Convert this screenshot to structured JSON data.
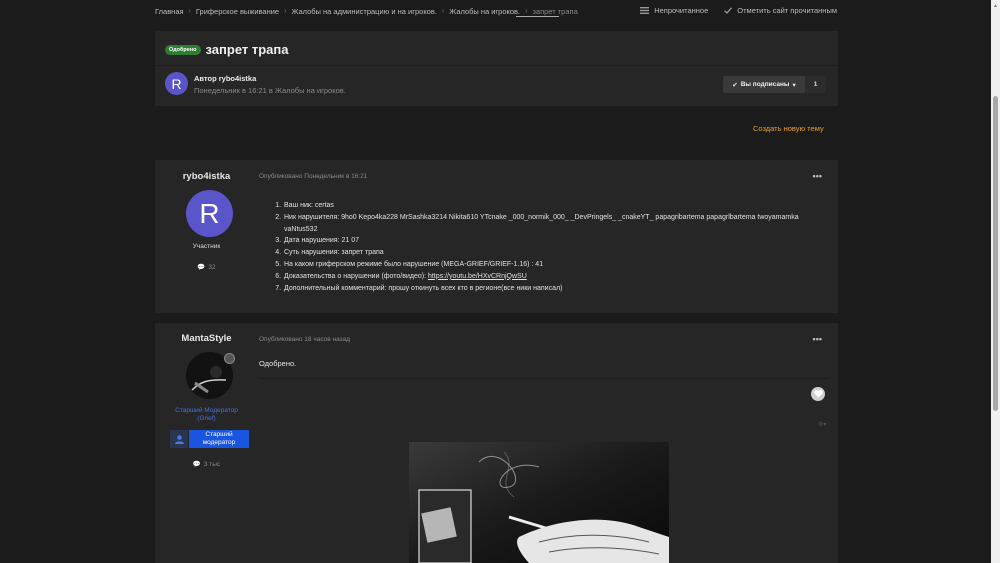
{
  "breadcrumb": {
    "items": [
      "Главная",
      "Гриферское выживание",
      "Жалобы на администрацию и на игроков.",
      "Жалобы на игроков.",
      "запрет трапа"
    ],
    "unread": "Непрочитанное",
    "mark_read": "Отметить сайт прочитанным"
  },
  "topic": {
    "badge": "Одобрено",
    "title": "запрет трапа",
    "author_initial": "R",
    "author_line": "Автор rybo4istka",
    "meta": "Понедельник в 16:21 в Жалобы на игроков.",
    "follow_label": "Вы подписаны",
    "follow_count": "1"
  },
  "new_topic": "Создать новую тему",
  "post1": {
    "username": "rybo4istka",
    "initial": "R",
    "role": "Участник",
    "posts_count": "32",
    "date": "Опубликовано Понедельник в 16:21",
    "menu": "•••",
    "items": [
      "Ваш ник: certas",
      "Ник нарушителя: 9ho0 Kepo4ka228 MrSashka3214 Nikita610 YTcnake _000_normik_000_ _DevPringels_ _cnakeYT_ papagribartema papagrlbartema twoyamamka vaNtus532",
      "Дата нарушения: 21 07",
      "Суть нарушения: запрет трапа",
      "На каком гриферском режиме было нарушение (MEGA-GRIEF/GRIEF-1.16) : 41",
      "Доказательства о нарушении (фото/видео): ",
      "Дополнительный комментарий: прошу откинуть всех кто в регионе(все ники написал)"
    ],
    "evidence_link": "https://youtu.be/HXvCRnjQwSU"
  },
  "post2": {
    "username": "MantaStyle",
    "role_line1": "Старший Модератор",
    "role_line2": "(Grief)",
    "group_line1": "Старший",
    "group_line2": "модератор",
    "posts_count": "3 тыс",
    "date": "Опубликовано 18 часов назад",
    "menu": "•••",
    "text": "Одобрено."
  },
  "colors": {
    "accent": "#e8a030",
    "approved_badge": "#2e7d32",
    "avatar": "#5a55c8",
    "mod_blue": "#1a55e0"
  }
}
